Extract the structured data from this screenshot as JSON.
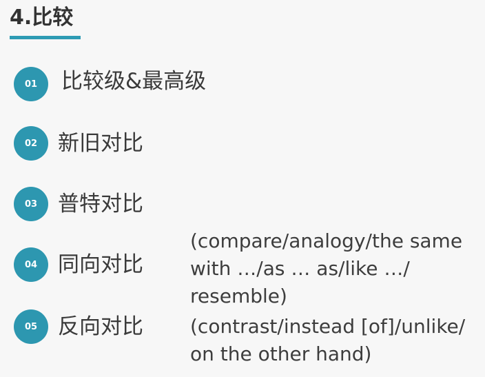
{
  "section": {
    "title": "4.比较"
  },
  "items": [
    {
      "number": "01",
      "label": "比较级&最高级"
    },
    {
      "number": "02",
      "label": "新旧对比"
    },
    {
      "number": "03",
      "label": "普特对比"
    },
    {
      "number": "04",
      "label": "同向对比"
    },
    {
      "number": "05",
      "label": "反向对比"
    }
  ],
  "notes": {
    "item4": [
      "(compare/analogy/the same",
      "with …/as … as/like …/",
      "resemble)"
    ],
    "item5": [
      "(contrast/instead [of]/unlike/",
      "on the other hand)"
    ]
  },
  "colors": {
    "accent": "#2d97b0"
  }
}
